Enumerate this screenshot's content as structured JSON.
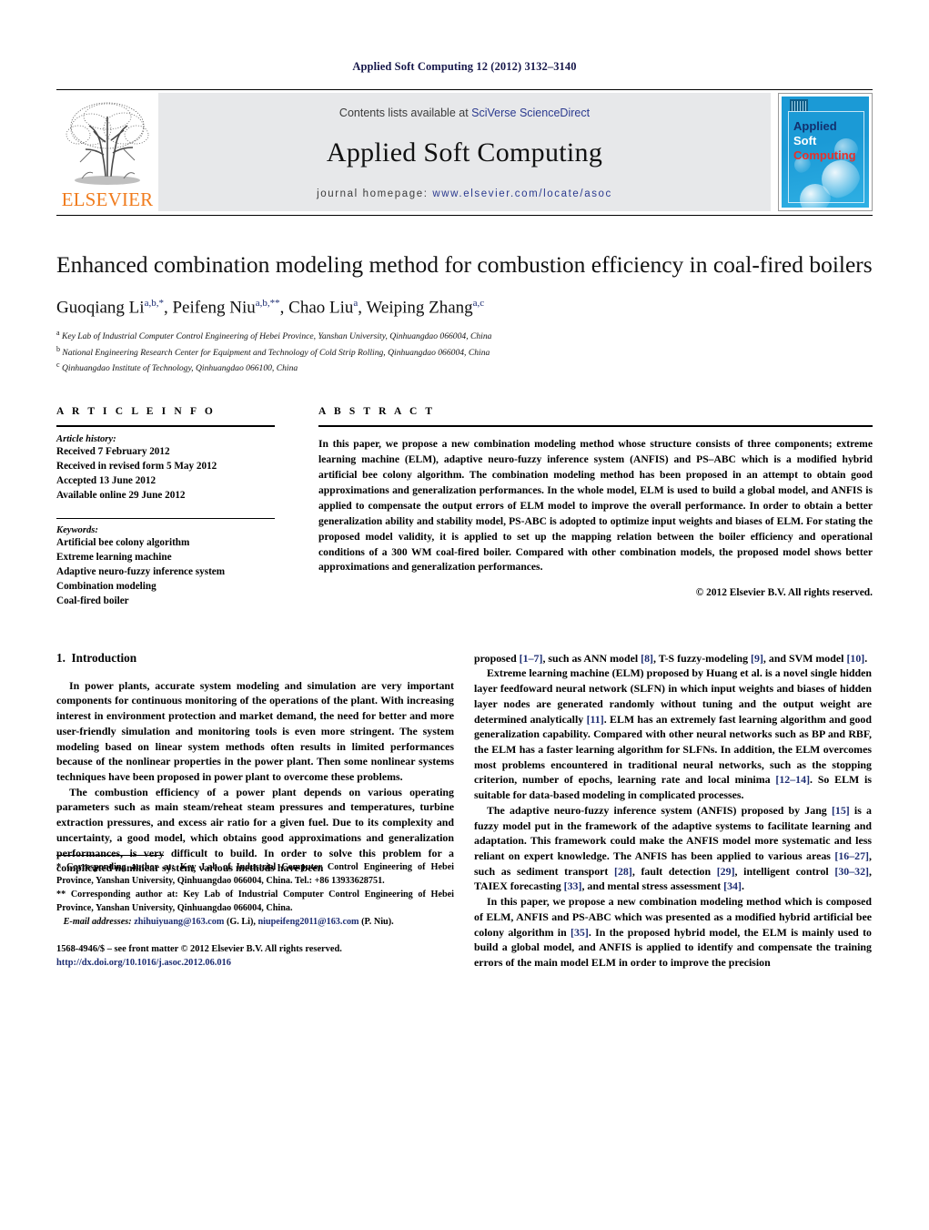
{
  "running_head": "Applied Soft Computing 12 (2012) 3132–3140",
  "masthead": {
    "contents_prefix": "Contents lists available at ",
    "sciencedirect": "SciVerse ScienceDirect",
    "journal_name": "Applied Soft Computing",
    "homepage_prefix": "journal homepage:",
    "homepage_url": "www.elsevier.com/locate/asoc",
    "publisher": "ELSEVIER",
    "publisher_color": "#f07c1e",
    "link_color": "#2b3a8f",
    "band_color": "#e7e8ea",
    "cover": {
      "line1": "Applied",
      "line2": "Soft",
      "line3": "Computing",
      "bg_color": "#1b9ad6",
      "line1_color": "#12306e",
      "line2_color": "#ffffff",
      "line3_color": "#e8312a"
    }
  },
  "article": {
    "title": "Enhanced combination modeling method for combustion efficiency in coal-fired boilers",
    "authors": [
      {
        "name": "Guoqiang Li",
        "marks": "a,b,*"
      },
      {
        "name": "Peifeng Niu",
        "marks": "a,b,**"
      },
      {
        "name": "Chao Liu",
        "marks": "a"
      },
      {
        "name": "Weiping Zhang",
        "marks": "a,c"
      }
    ],
    "affiliations": [
      {
        "mark": "a",
        "text": "Key Lab of Industrial Computer Control Engineering of Hebei Province, Yanshan University, Qinhuangdao 066004, China"
      },
      {
        "mark": "b",
        "text": "National Engineering Research Center for Equipment and Technology of Cold Strip Rolling, Qinhuangdao 066004, China"
      },
      {
        "mark": "c",
        "text": "Qinhuangdao Institute of Technology, Qinhuangdao 066100, China"
      }
    ]
  },
  "article_info": {
    "heading": "A R T I C L E    I N F O",
    "history_title": "Article history:",
    "history": [
      "Received 7 February 2012",
      "Received in revised form 5 May 2012",
      "Accepted 13 June 2012",
      "Available online 29 June 2012"
    ],
    "keywords_title": "Keywords:",
    "keywords": [
      "Artificial bee colony algorithm",
      "Extreme learning machine",
      "Adaptive neuro-fuzzy inference system",
      "Combination modeling",
      "Coal-fired boiler"
    ]
  },
  "abstract": {
    "heading": "A B S T R A C T",
    "text": "In this paper, we propose a new combination modeling method whose structure consists of three components; extreme learning machine (ELM), adaptive neuro-fuzzy inference system (ANFIS) and PS–ABC which is a modified hybrid artificial bee colony algorithm. The combination modeling method has been proposed in an attempt to obtain good approximations and generalization performances. In the whole model, ELM is used to build a global model, and ANFIS is applied to compensate the output errors of ELM model to improve the overall performance. In order to obtain a better generalization ability and stability model, PS-ABC is adopted to optimize input weights and biases of ELM. For stating the proposed model validity, it is applied to set up the mapping relation between the boiler efficiency and operational conditions of a 300 WM coal-fired boiler. Compared with other combination models, the proposed model shows better approximations and generalization performances.",
    "copyright": "© 2012 Elsevier B.V. All rights reserved."
  },
  "introduction": {
    "section_number": "1.",
    "section_title": "Introduction",
    "left_paragraphs": [
      "In power plants, accurate system modeling and simulation are very important components for continuous monitoring of the operations of the plant. With increasing interest in environment protection and market demand, the need for better and more user-friendly simulation and monitoring tools is even more stringent. The system modeling based on linear system methods often results in limited performances because of the nonlinear properties in the power plant. Then some nonlinear systems techniques have been proposed in power plant to overcome these problems.",
      "The combustion efficiency of a power plant depends on various operating parameters such as main steam/reheat steam pressures and temperatures, turbine extraction pressures, and excess air ratio for a given fuel. Due to its complexity and uncertainty, a good model, which obtains good approximations and generalization performances, is very difficult to build. In order to solve this problem for a complicated nonlinear system, various methods have been"
    ],
    "right_paragraphs": [
      "proposed [1–7], such as ANN model [8], T-S fuzzy-modeling [9], and SVM model [10].",
      "Extreme learning machine (ELM) proposed by Huang et al. is a novel single hidden layer feedfoward neural network (SLFN) in which input weights and biases of hidden layer nodes are generated randomly without tuning and the output weight are determined analytically [11]. ELM has an extremely fast learning algorithm and good generalization capability. Compared with other neural networks such as BP and RBF, the ELM has a faster learning algorithm for SLFNs. In addition, the ELM overcomes most problems encountered in traditional neural networks, such as the stopping criterion, number of epochs, learning rate and local minima [12–14]. So ELM is suitable for data-based modeling in complicated processes.",
      "The adaptive neuro-fuzzy inference system (ANFIS) proposed by Jang [15] is a fuzzy model put in the framework of the adaptive systems to facilitate learning and adaptation. This framework could make the ANFIS model more systematic and less reliant on expert knowledge. The ANFIS has been applied to various areas [16–27], such as sediment transport [28], fault detection [29], intelligent control [30–32], TAIEX forecasting [33], and mental stress assessment [34].",
      "In this paper, we propose a new combination modeling method which is composed of ELM, ANFIS and PS-ABC which was presented as a modified hybrid artificial bee colony algorithm in [35]. In the proposed hybrid model, the ELM is mainly used to build a global model, and ANFIS is applied to identify and compensate the training errors of the main model ELM in order to improve the precision"
    ]
  },
  "footnotes": {
    "note1": "* Corresponding author at: Key Lab of Industrial Computer Control Engineering of Hebei Province, Yanshan University, Qinhuangdao 066004, China. Tel.: +86 13933628751.",
    "note2": "** Corresponding author at: Key Lab of Industrial Computer Control Engineering of Hebei Province, Yanshan University, Qinhuangdao 066004, China.",
    "email_label": "E-mail addresses:",
    "email1": "zhihuiyuang@163.com",
    "email1_owner": "(G. Li),",
    "email2": "niupeifeng2011@163.com",
    "email2_owner": "(P. Niu).",
    "front_matter": "1568-4946/$ – see front matter © 2012 Elsevier B.V. All rights reserved.",
    "doi": "http://dx.doi.org/10.1016/j.asoc.2012.06.016"
  }
}
